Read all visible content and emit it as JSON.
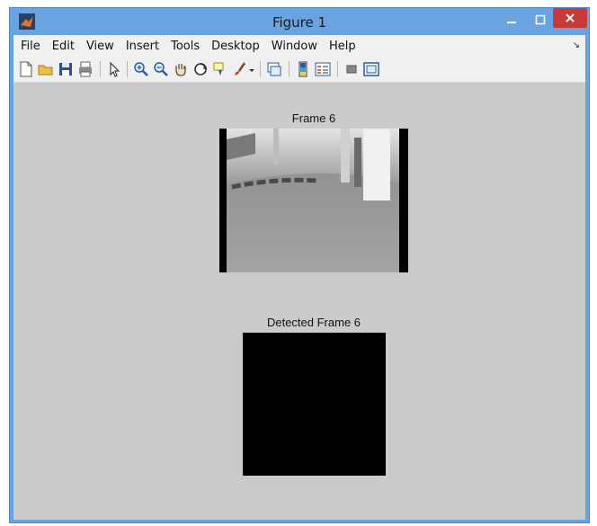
{
  "window": {
    "title": "Figure 1"
  },
  "menu": [
    "File",
    "Edit",
    "View",
    "Insert",
    "Tools",
    "Desktop",
    "Window",
    "Help"
  ],
  "toolbar": [
    "new-figure",
    "open-file",
    "save",
    "print",
    "edit-plot",
    "zoom-in",
    "zoom-out",
    "pan",
    "rotate-3d",
    "data-cursor",
    "brush",
    "link-plot",
    "colorbar",
    "legend",
    "hide-plot-tools",
    "show-plot-tools"
  ],
  "axes": [
    {
      "title": "Frame 6"
    },
    {
      "title": "Detected Frame 6"
    }
  ],
  "colors": {
    "figure_bg": "#cccbcc",
    "close_button": "#c73a3a",
    "titlebar": "#6aa3e0"
  }
}
